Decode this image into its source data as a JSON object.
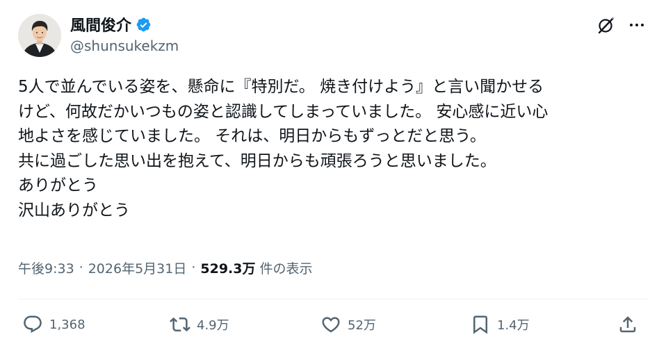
{
  "author": {
    "display_name": "風間俊介",
    "handle": "@shunsukekzm",
    "verified": true,
    "verified_color": "#1d9bf0"
  },
  "header_actions": {
    "grok_icon": "grok-icon",
    "more_icon": "more-icon"
  },
  "tweet": {
    "lines": [
      "5人で並んでいる姿を、懸命に『特別だ。 焼き付けよう』と言い聞かせる",
      "けど、何故だかいつもの姿と認識してしまっていました。 安心感に近い心",
      "地よさを感じていました。 それは、明日からもずっとだと思う。",
      "共に過ごした思い出を抱えて、明日からも頑張ろうと思いました。",
      "ありがとう",
      "沢山ありがとう"
    ]
  },
  "meta": {
    "time": "午後9:33",
    "date": "2026年5月31日",
    "views_count": "529.3万",
    "views_label": "件の表示",
    "separator": "·"
  },
  "actions": {
    "reply_count": "1,368",
    "repost_count": "4.9万",
    "like_count": "52万",
    "bookmark_count": "1.4万"
  },
  "colors": {
    "text_primary": "#0f1419",
    "text_secondary": "#536471",
    "divider": "#eff3f4"
  }
}
